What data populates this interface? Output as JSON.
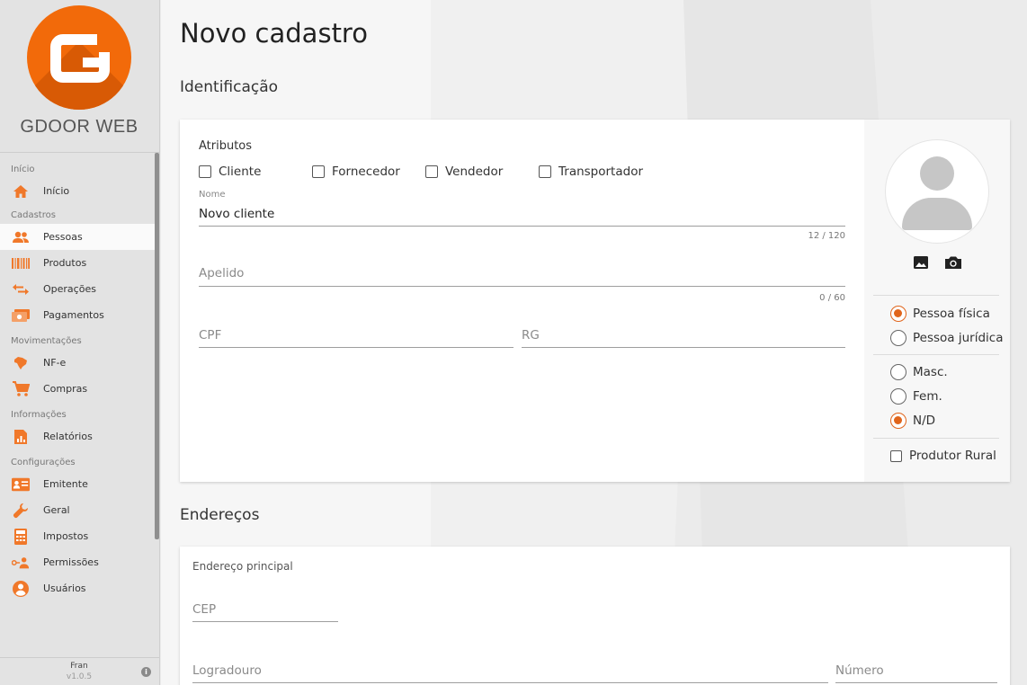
{
  "sidebar": {
    "brand": "GDOOR WEB",
    "sections": [
      {
        "label": "Início",
        "items": [
          {
            "label": "Início",
            "icon": "home-icon"
          }
        ]
      },
      {
        "label": "Cadastros",
        "items": [
          {
            "label": "Pessoas",
            "icon": "people-icon",
            "active": true
          },
          {
            "label": "Produtos",
            "icon": "barcode-icon"
          },
          {
            "label": "Operações",
            "icon": "swap-arrows-icon"
          },
          {
            "label": "Pagamentos",
            "icon": "cash-icon"
          }
        ]
      },
      {
        "label": "Movimentações",
        "items": [
          {
            "label": "NF-e",
            "icon": "brazil-map-icon"
          },
          {
            "label": "Compras",
            "icon": "cart-icon"
          }
        ]
      },
      {
        "label": "Informações",
        "items": [
          {
            "label": "Relatórios",
            "icon": "report-icon"
          }
        ]
      },
      {
        "label": "Configurações",
        "items": [
          {
            "label": "Emitente",
            "icon": "id-card-icon"
          },
          {
            "label": "Geral",
            "icon": "wrench-icon"
          },
          {
            "label": "Impostos",
            "icon": "calculator-icon"
          },
          {
            "label": "Permissões",
            "icon": "key-user-icon"
          },
          {
            "label": "Usuários",
            "icon": "account-icon"
          }
        ]
      }
    ],
    "footer": {
      "user": "Fran",
      "version": "v1.0.5"
    }
  },
  "page": {
    "title": "Novo cadastro",
    "section_ident": "Identificação",
    "section_end": "Endereços"
  },
  "ident": {
    "attributes_label": "Atributos",
    "attributes": [
      "Cliente",
      "Fornecedor",
      "Vendedor",
      "Transportador"
    ],
    "nome": {
      "label": "Nome",
      "value": "Novo cliente",
      "counter": "12 / 120"
    },
    "apelido": {
      "placeholder": "Apelido",
      "counter": "0 / 60"
    },
    "cpf": {
      "placeholder": "CPF"
    },
    "rg": {
      "placeholder": "RG"
    }
  },
  "side": {
    "person_type": {
      "options": [
        "Pessoa física",
        "Pessoa jurídica"
      ],
      "selected": "Pessoa física"
    },
    "gender": {
      "options": [
        "Masc.",
        "Fem.",
        "N/D"
      ],
      "selected": "N/D"
    },
    "produtor_rural": "Produtor Rural"
  },
  "enderecos": {
    "subtitle": "Endereço principal",
    "cep": "CEP",
    "logradouro": "Logradouro",
    "numero": "Número"
  },
  "colors": {
    "accent": "#e0651c",
    "brand": "#f26a0a",
    "sidebar_bg": "#e3e3e3"
  }
}
